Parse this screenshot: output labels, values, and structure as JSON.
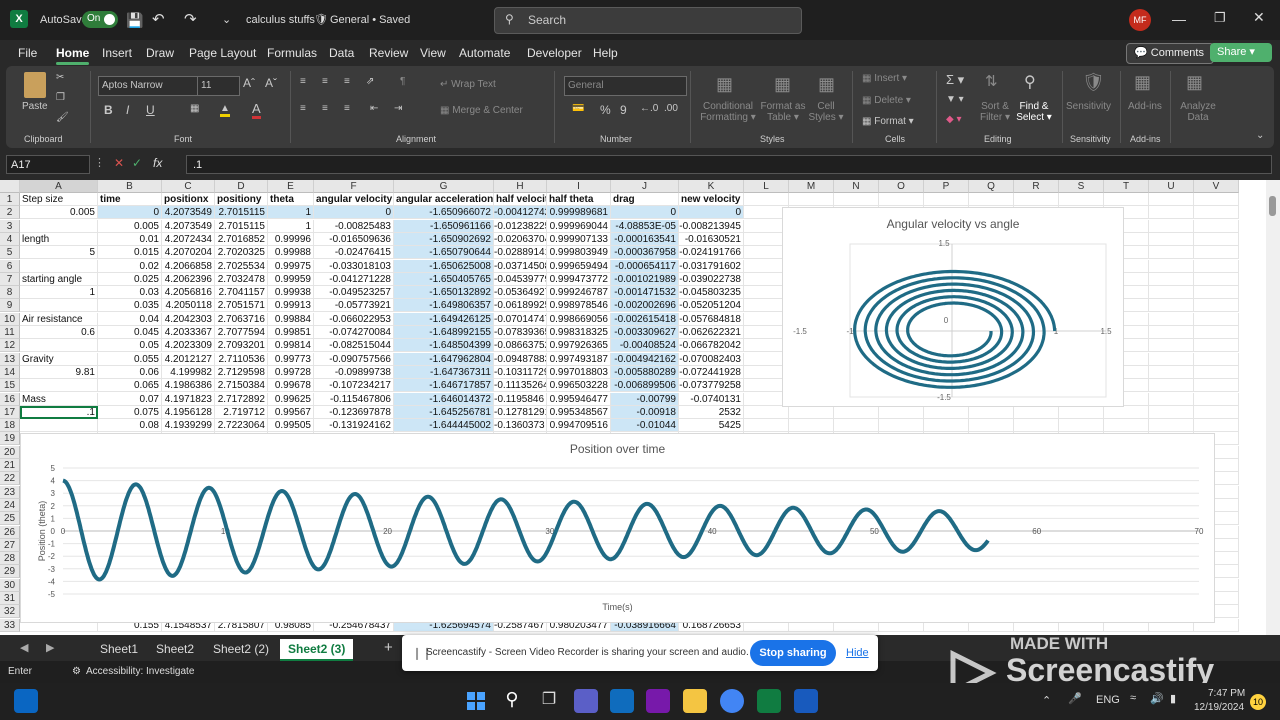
{
  "titlebar": {
    "app_icon": "X",
    "autosave": "AutoSave",
    "toggle": "On",
    "filename": "calculus stuffs",
    "sensitivity": "General • Saved",
    "search_placeholder": "Search",
    "avatar": "MF"
  },
  "menu": [
    "File",
    "Home",
    "Insert",
    "Draw",
    "Page Layout",
    "Formulas",
    "Data",
    "Review",
    "View",
    "Automate",
    "Developer",
    "Help"
  ],
  "comments": "Comments",
  "share": "Share",
  "ribbon": {
    "paste": "Paste",
    "clipboard": "Clipboard",
    "font_name": "Aptos Narrow",
    "font_size": "11",
    "font": "Font",
    "wrap": "Wrap Text",
    "merge": "Merge & Center",
    "alignment": "Alignment",
    "numfmt": "General",
    "number": "Number",
    "cond1": "Conditional",
    "cond2": "Formatting",
    "fmt1": "Format as",
    "fmt2": "Table",
    "cell1": "Cell",
    "cell2": "Styles",
    "styles": "Styles",
    "insert": "Insert",
    "delete": "Delete",
    "format": "Format",
    "cells": "Cells",
    "sort1": "Sort &",
    "sort2": "Filter",
    "find1": "Find &",
    "find2": "Select",
    "editing": "Editing",
    "sensitivity": "Sensitivity",
    "addins": "Add-ins",
    "analyze1": "Analyze",
    "analyze2": "Data"
  },
  "formula": {
    "namebox": "A17",
    "fx": "fx",
    "value": ".1"
  },
  "columns": [
    "A",
    "B",
    "C",
    "D",
    "E",
    "F",
    "G",
    "H",
    "I",
    "J",
    "K",
    "L",
    "M",
    "N",
    "O",
    "P",
    "Q",
    "R",
    "S",
    "T",
    "U",
    "V"
  ],
  "rows": [
    [
      "Step size",
      "time",
      "positionx",
      "positiony",
      "theta",
      "angular velocity",
      "angular acceleration",
      "half velocity",
      "half theta",
      "drag",
      "new velocity"
    ],
    [
      "0.005",
      "0",
      "4.2073549",
      "2.7015115",
      "1",
      "0",
      "-1.650966072",
      "-0.00412742",
      "0.999989681",
      "0",
      "0"
    ],
    [
      "",
      "0.005",
      "4.2073549",
      "2.7015115",
      "1",
      "-0.00825483",
      "-1.650961166",
      "-0.01238225",
      "0.999969044",
      "-4.08853E-05",
      "-0.008213945"
    ],
    [
      "length",
      "0.01",
      "4.2072434",
      "2.7016852",
      "0.99996",
      "-0.016509636",
      "-1.650902692",
      "-0.02063704",
      "0.999907133",
      "-0.000163541",
      "-0.01630521"
    ],
    [
      "5",
      "0.015",
      "4.2070204",
      "2.7020325",
      "0.99988",
      "-0.02476415",
      "-1.650790644",
      "-0.02889141",
      "0.999803949",
      "-0.000367958",
      "-0.024191766"
    ],
    [
      "",
      "0.02",
      "4.2066858",
      "2.7025534",
      "0.99975",
      "-0.033018103",
      "-1.650625008",
      "-0.03714508",
      "0.999659494",
      "-0.000654117",
      "-0.031791602"
    ],
    [
      "starting angle",
      "0.025",
      "4.2062396",
      "2.7032478",
      "0.99959",
      "-0.041271228",
      "-1.650405765",
      "-0.04539779",
      "0.999473772",
      "-0.001021989",
      "-0.039022738"
    ],
    [
      "1",
      "0.03",
      "4.2056816",
      "2.7041157",
      "0.99938",
      "-0.049523257",
      "-1.650132892",
      "-0.05364927",
      "0.999246787",
      "-0.001471532",
      "-0.045803235"
    ],
    [
      "",
      "0.035",
      "4.2050118",
      "2.7051571",
      "0.99913",
      "-0.05773921",
      "-1.649806357",
      "-0.06189925",
      "0.998978546",
      "-0.002002696",
      "-0.052051204"
    ],
    [
      "Air resistance",
      "0.04",
      "4.2042303",
      "2.7063716",
      "0.99884",
      "-0.066022953",
      "-1.649426125",
      "-0.07014747",
      "0.998669056",
      "-0.002615418",
      "-0.057684818"
    ],
    [
      "0.6",
      "0.045",
      "4.2033367",
      "2.7077594",
      "0.99851",
      "-0.074270084",
      "-1.648992155",
      "-0.07839365",
      "0.998318325",
      "-0.003309627",
      "-0.062622321"
    ],
    [
      "",
      "0.05",
      "4.2023309",
      "2.7093201",
      "0.99814",
      "-0.082515044",
      "-1.648504399",
      "-0.08663752",
      "0.997926365",
      "-0.00408524",
      "-0.066782042"
    ],
    [
      "Gravity",
      "0.055",
      "4.2012127",
      "2.7110536",
      "0.99773",
      "-0.090757566",
      "-1.647962804",
      "-0.09487883",
      "0.997493187",
      "-0.004942162",
      "-0.070082403"
    ],
    [
      "9.81",
      "0.06",
      "4.199982",
      "2.7129598",
      "0.99728",
      "-0.09899738",
      "-1.647367311",
      "-0.10311729",
      "0.997018803",
      "-0.005880289",
      "-0.072441928"
    ],
    [
      "",
      "0.065",
      "4.1986386",
      "2.7150384",
      "0.99678",
      "-0.107234217",
      "-1.646717857",
      "-0.11135264",
      "0.996503228",
      "-0.006899506",
      "-0.073779258"
    ],
    [
      "Mass",
      "0.07",
      "4.1971823",
      "2.7172892",
      "0.99625",
      "-0.115467806",
      "-1.646014372",
      "-0.1195846",
      "0.995946477",
      "-0.00799",
      "-0.0740131"
    ],
    [
      ".1",
      "0.075",
      "4.1956128",
      "2.719712",
      "0.99567",
      "-0.123697878",
      "-1.645256781",
      "-0.12781291",
      "0.995348567",
      "-0.00918",
      "2532"
    ],
    [
      "",
      "0.08",
      "4.1939299",
      "2.7223064",
      "0.99505",
      "-0.131924162",
      "-1.644445002",
      "-0.1360373",
      "0.994709516",
      "-0.01044",
      "5425"
    ]
  ],
  "row33": [
    "",
    "0.155",
    "4.1548537",
    "2.7815807",
    "0.98085",
    "-0.254678437",
    "-1.625694574",
    "-0.25874677",
    "0.980203477",
    "-0.038916664",
    "0.168726653"
  ],
  "chart1": {
    "title": "Angular velocity vs angle",
    "ticks": [
      "1.5",
      "-1.5",
      "-1",
      "0",
      "1",
      "1.5",
      "-1.5",
      "0"
    ]
  },
  "chart2": {
    "title": "Position over time",
    "xlabel": "Time(s)",
    "ylabel": "Position (theta)"
  },
  "chart_data": [
    {
      "type": "scatter",
      "title": "Angular velocity vs angle",
      "xlim": [
        -1.5,
        1.5
      ],
      "ylim": [
        -1.5,
        1.5
      ],
      "description_series": "phase spiral decaying",
      "x_ticks": [
        "-1.5",
        "-1",
        "0",
        "1",
        "1.5"
      ],
      "y_ticks": [
        "1.5",
        "0",
        "-1.5"
      ]
    },
    {
      "type": "line",
      "title": "Position over time",
      "xlabel": "Time(s)",
      "ylabel": "Position (theta)",
      "xlim": [
        0,
        70
      ],
      "ylim": [
        -5,
        5
      ],
      "x_ticks": [
        "0",
        "10",
        "20",
        "30",
        "40",
        "50",
        "60",
        "70"
      ],
      "y_ticks": [
        "5",
        "4",
        "3",
        "2",
        "1",
        "0",
        "-1",
        "-2",
        "-3",
        "-4",
        "-5"
      ],
      "amplitude_start": 4,
      "amplitude_end": 1.5,
      "period": 4.5,
      "t_end": 57
    }
  ],
  "sheets": [
    "Sheet1",
    "Sheet2",
    "Sheet2 (2)",
    "Sheet2 (3)"
  ],
  "status": {
    "mode": "Enter",
    "access": "Accessibility: Investigate"
  },
  "screencastify": {
    "msg": "Screencastify - Screen Video Recorder is sharing your screen and audio.",
    "stop": "Stop sharing",
    "hide": "Hide",
    "made": "MADE WITH",
    "brand": "Screencastify"
  },
  "taskbar": {
    "lang": "ENG",
    "time": "7:47 PM",
    "date": "12/19/2024",
    "badge": "10"
  }
}
